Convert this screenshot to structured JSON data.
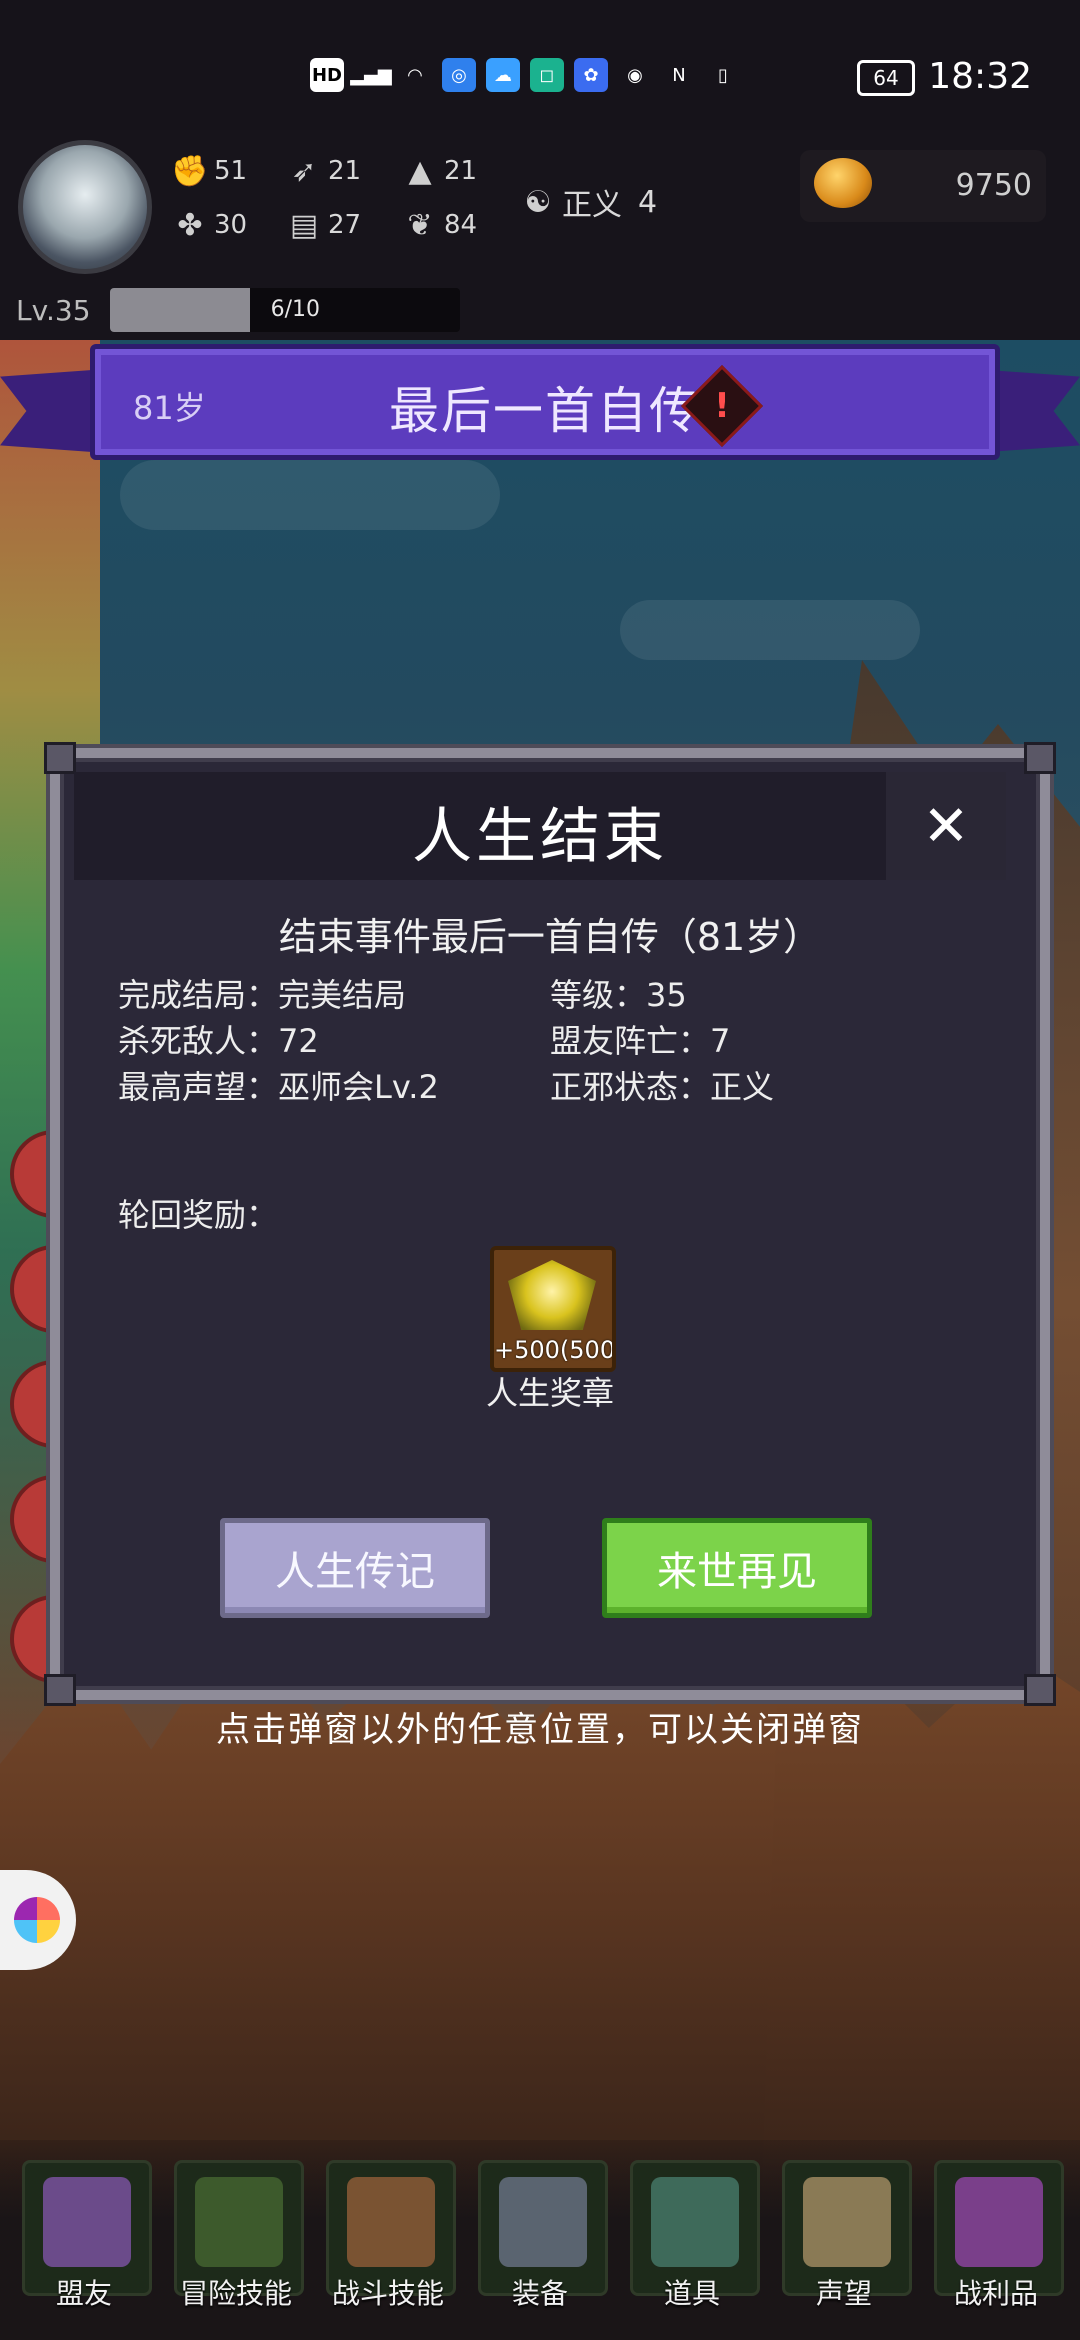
{
  "status_bar": {
    "icons": [
      "HD",
      "5G",
      "signal",
      "wifi",
      "app-blue",
      "weather",
      "app-green",
      "baidu",
      "eye",
      "nfc",
      "vibrate"
    ],
    "battery": "64",
    "time": "18:32"
  },
  "header": {
    "stats": [
      {
        "icon": "fist-icon",
        "value": "51"
      },
      {
        "icon": "clover-icon",
        "value": "30"
      },
      {
        "icon": "wing-icon",
        "value": "21"
      },
      {
        "icon": "book-icon",
        "value": "27"
      },
      {
        "icon": "hat-icon",
        "value": "21"
      },
      {
        "icon": "leaf-icon",
        "value": "84"
      }
    ],
    "alignment": {
      "icon": "yinyang-icon",
      "label": "正义",
      "value": "4"
    },
    "coins": "9750",
    "level": "Lv.35",
    "xp_text": "6/10",
    "xp_fraction": 0.4
  },
  "banner": {
    "age": "81岁",
    "title": "最后一首自传",
    "alert_symbol": "!"
  },
  "modal": {
    "title": "人生结束",
    "close_symbol": "✕",
    "event_line": "结束事件最后一首自传（81岁）",
    "info": {
      "ending": "完成结局：完美结局",
      "level": "等级：35",
      "kills": "杀死敌人：72",
      "ally_deaths": "盟友阵亡：7",
      "reputation": "最高声望：巫师会Lv.2",
      "alignment": "正邪状态：正义"
    },
    "reward_label": "轮回奖励：",
    "reward": {
      "amount": "+500(500",
      "name": "人生奖章"
    },
    "buttons": {
      "biography": "人生传记",
      "next_life": "来世再见"
    }
  },
  "hint": "点击弹窗以外的任意位置，可以关闭弹窗",
  "bottom_nav": [
    {
      "label": "盟友",
      "icon": "gloves-icon",
      "color": "#6b4b8a"
    },
    {
      "label": "冒险技能",
      "icon": "green-book-icon",
      "color": "#3d5a2c"
    },
    {
      "label": "战斗技能",
      "icon": "backpack-icon",
      "color": "#7a5332"
    },
    {
      "label": "装备",
      "icon": "crossed-swords-icon",
      "color": "#5a6470"
    },
    {
      "label": "道具",
      "icon": "pouch-icon",
      "color": "#3e6a5a"
    },
    {
      "label": "声望",
      "icon": "scroll-icon",
      "color": "#8a7a55"
    },
    {
      "label": "战利品",
      "icon": "treasure-chest-icon",
      "color": "#7a3f8a"
    }
  ]
}
